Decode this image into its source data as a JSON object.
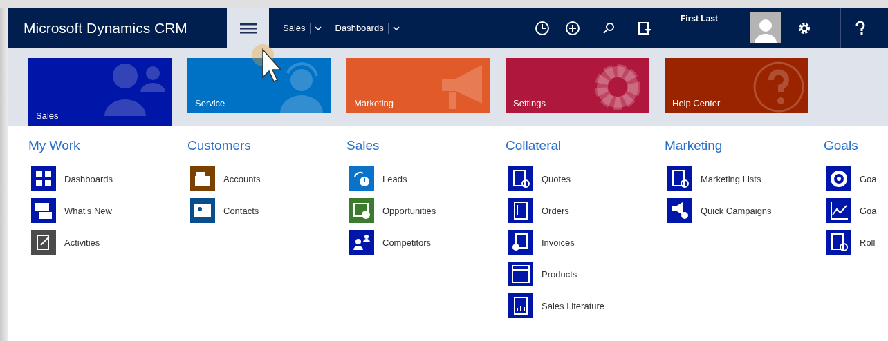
{
  "top_bar": {
    "brand": "Microsoft Dynamics CRM",
    "menu_open": true,
    "nav": [
      {
        "label": "Sales"
      },
      {
        "label": "Dashboards"
      }
    ],
    "user": "First Last"
  },
  "tiles": [
    {
      "label": "Sales",
      "color": "#0016a8",
      "selected": true
    },
    {
      "label": "Service",
      "color": "#0072c6",
      "selected": false
    },
    {
      "label": "Marketing",
      "color": "#e05a2a",
      "selected": false
    },
    {
      "label": "Settings",
      "color": "#b0173d",
      "selected": false
    },
    {
      "label": "Help Center",
      "color": "#9b2400",
      "selected": false
    }
  ],
  "groups": [
    {
      "title": "My Work",
      "items": [
        {
          "label": "Dashboards",
          "color": "#0016a8"
        },
        {
          "label": "What's New",
          "color": "#0016a8"
        },
        {
          "label": "Activities",
          "color": "#4b4b4b"
        }
      ]
    },
    {
      "title": "Customers",
      "items": [
        {
          "label": "Accounts",
          "color": "#7a4100"
        },
        {
          "label": "Contacts",
          "color": "#0a4d8c"
        }
      ]
    },
    {
      "title": "Sales",
      "items": [
        {
          "label": "Leads",
          "color": "#0a72c8"
        },
        {
          "label": "Opportunities",
          "color": "#3c7a2e"
        },
        {
          "label": "Competitors",
          "color": "#0016a8"
        }
      ]
    },
    {
      "title": "Collateral",
      "items": [
        {
          "label": "Quotes",
          "color": "#0016a8"
        },
        {
          "label": "Orders",
          "color": "#0016a8"
        },
        {
          "label": "Invoices",
          "color": "#0016a8"
        },
        {
          "label": "Products",
          "color": "#0016a8"
        },
        {
          "label": "Sales Literature",
          "color": "#0016a8"
        }
      ]
    },
    {
      "title": "Marketing",
      "items": [
        {
          "label": "Marketing Lists",
          "color": "#0016a8"
        },
        {
          "label": "Quick Campaigns",
          "color": "#0016a8"
        }
      ]
    },
    {
      "title": "Goals",
      "items": [
        {
          "label": "Goa",
          "color": "#0016a8"
        },
        {
          "label": "Goa",
          "color": "#0016a8"
        },
        {
          "label": "Roll",
          "color": "#0016a8"
        }
      ]
    }
  ]
}
